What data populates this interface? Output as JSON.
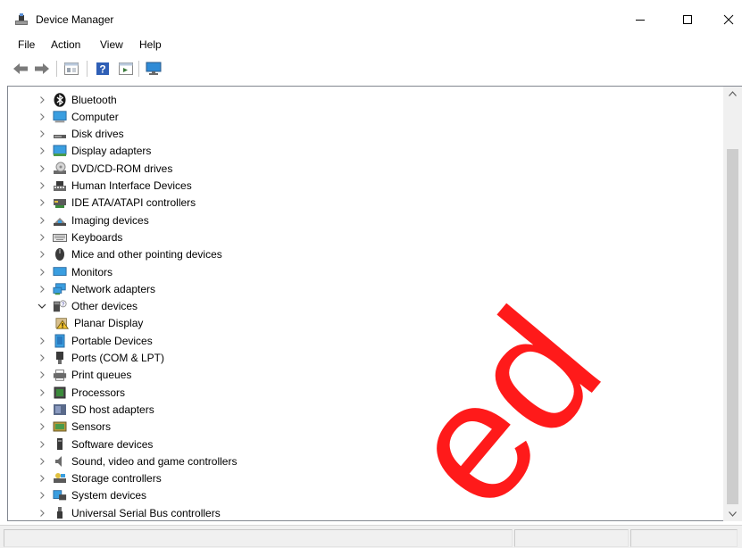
{
  "window": {
    "title": "Device Manager"
  },
  "menu": {
    "items": [
      "File",
      "Action",
      "View",
      "Help"
    ]
  },
  "toolbar": {
    "buttons": [
      "back-icon",
      "forward-icon",
      "properties-icon",
      "help-icon",
      "run-icon",
      "monitor-icon"
    ]
  },
  "tree": {
    "items": [
      {
        "label": "Bluetooth",
        "icon": "bluetooth-icon",
        "expanded": false
      },
      {
        "label": "Computer",
        "icon": "computer-icon",
        "expanded": false
      },
      {
        "label": "Disk drives",
        "icon": "disk-drive-icon",
        "expanded": false
      },
      {
        "label": "Display adapters",
        "icon": "display-adapter-icon",
        "expanded": false
      },
      {
        "label": "DVD/CD-ROM drives",
        "icon": "dvd-drive-icon",
        "expanded": false
      },
      {
        "label": "Human Interface Devices",
        "icon": "hid-icon",
        "expanded": false
      },
      {
        "label": "IDE ATA/ATAPI controllers",
        "icon": "ide-controller-icon",
        "expanded": false
      },
      {
        "label": "Imaging devices",
        "icon": "imaging-device-icon",
        "expanded": false
      },
      {
        "label": "Keyboards",
        "icon": "keyboard-icon",
        "expanded": false
      },
      {
        "label": "Mice and other pointing devices",
        "icon": "mouse-icon",
        "expanded": false
      },
      {
        "label": "Monitors",
        "icon": "monitor-icon",
        "expanded": false
      },
      {
        "label": "Network adapters",
        "icon": "network-adapter-icon",
        "expanded": false
      },
      {
        "label": "Other devices",
        "icon": "unknown-device-icon",
        "expanded": true
      },
      {
        "label": "Planar Display",
        "icon": "warning-device-icon",
        "child": true
      },
      {
        "label": "Portable Devices",
        "icon": "portable-device-icon",
        "expanded": false
      },
      {
        "label": "Ports (COM & LPT)",
        "icon": "port-icon",
        "expanded": false
      },
      {
        "label": "Print queues",
        "icon": "printer-icon",
        "expanded": false
      },
      {
        "label": "Processors",
        "icon": "processor-icon",
        "expanded": false
      },
      {
        "label": "SD host adapters",
        "icon": "sd-adapter-icon",
        "expanded": false
      },
      {
        "label": "Sensors",
        "icon": "sensor-icon",
        "expanded": false
      },
      {
        "label": "Software devices",
        "icon": "software-device-icon",
        "expanded": false
      },
      {
        "label": "Sound, video and game controllers",
        "icon": "sound-icon",
        "expanded": false
      },
      {
        "label": "Storage controllers",
        "icon": "storage-controller-icon",
        "expanded": false
      },
      {
        "label": "System devices",
        "icon": "system-device-icon",
        "expanded": false
      },
      {
        "label": "Universal Serial Bus controllers",
        "icon": "usb-icon",
        "expanded": false
      }
    ]
  },
  "watermark": {
    "text": "ed",
    "color": "#ff1a1a"
  }
}
